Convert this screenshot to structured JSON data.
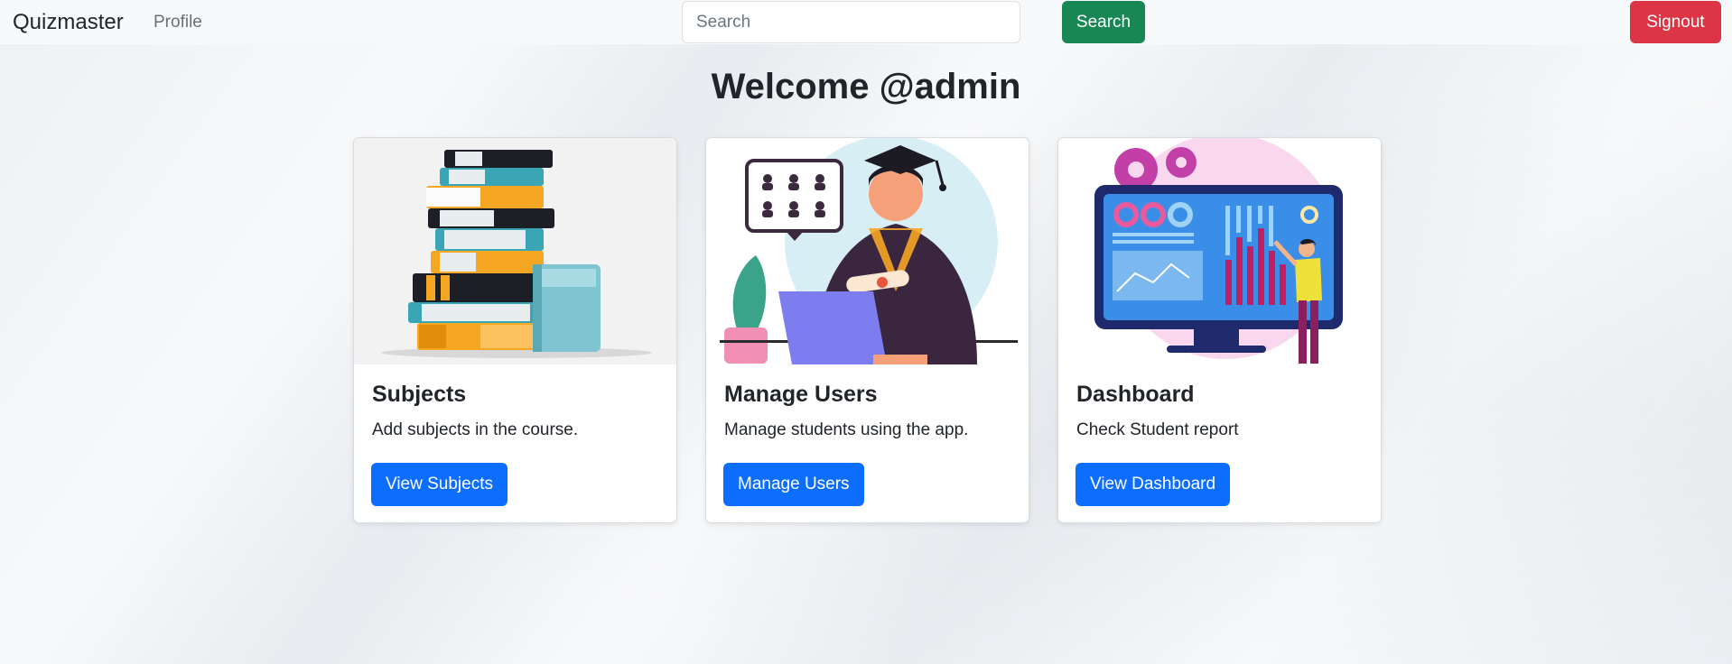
{
  "navbar": {
    "brand": "Quizmaster",
    "profile_link": "Profile",
    "search_placeholder": "Search",
    "search_button": "Search",
    "signout_button": "Signout"
  },
  "main": {
    "welcome": "Welcome @admin",
    "cards": [
      {
        "title": "Subjects",
        "text": "Add subjects in the course.",
        "button": "View Subjects",
        "image_icon": "book-stack-illustration"
      },
      {
        "title": "Manage Users",
        "text": "Manage students using the app.",
        "button": "Manage Users",
        "image_icon": "graduate-student-illustration"
      },
      {
        "title": "Dashboard",
        "text": "Check Student report",
        "button": "View Dashboard",
        "image_icon": "analytics-monitor-illustration"
      }
    ]
  },
  "colors": {
    "navbar_bg": "#f8f9fa",
    "search_btn": "#198754",
    "signout_btn": "#dc3545",
    "primary_btn": "#0d6efd"
  }
}
